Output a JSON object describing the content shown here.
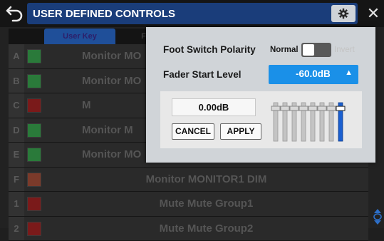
{
  "header": {
    "title": "USER DEFINED CONTROLS"
  },
  "tabs": [
    {
      "label": "User Key"
    },
    {
      "label": "Foot"
    }
  ],
  "rows": [
    {
      "letter": "A",
      "label": "Monitor MO",
      "swatch": "#2a7a3a",
      "align": "left"
    },
    {
      "letter": "B",
      "label": "Monitor MO",
      "swatch": "#2a7a3a",
      "align": "left"
    },
    {
      "letter": "C",
      "label": "M",
      "swatch": "#7a1a1a",
      "align": "left"
    },
    {
      "letter": "D",
      "label": "Monitor M",
      "swatch": "#2a7a3a",
      "align": "left"
    },
    {
      "letter": "E",
      "label": "Monitor MO",
      "swatch": "#2a7a3a",
      "align": "left"
    },
    {
      "letter": "F",
      "label": "Monitor MONITOR1 DIM",
      "swatch": "#7a3a2a",
      "align": "center"
    },
    {
      "letter": "1",
      "label": "Mute Mute Group1",
      "swatch": "#7a1a1a",
      "align": "center"
    },
    {
      "letter": "2",
      "label": "Mute Mute Group2",
      "swatch": "#7a1a1a",
      "align": "center"
    }
  ],
  "popup": {
    "foot_switch_label": "Foot Switch Polarity",
    "normal_label": "Normal",
    "invert_label": "Invert",
    "toggle_state": "Normal",
    "fader_start_label": "Fader Start Level",
    "fader_start_value": "-60.0dB",
    "fader_start_arrow": "▲",
    "value_display": "0.00dB",
    "cancel_label": "CANCEL",
    "apply_label": "APPLY",
    "fader_level": 0.85
  },
  "colors": {
    "title_bar": "#1a3d7a",
    "tab_active": "#1f4f99",
    "dropdown": "#1a90e8",
    "popup_bg": "#d0d4d8",
    "fader_indicator": "#1a5fd0"
  },
  "icons": {
    "back": "back-arrow-icon",
    "settings": "gear-icon",
    "close": "close-icon",
    "scroll": "scroll-handle-icon"
  }
}
